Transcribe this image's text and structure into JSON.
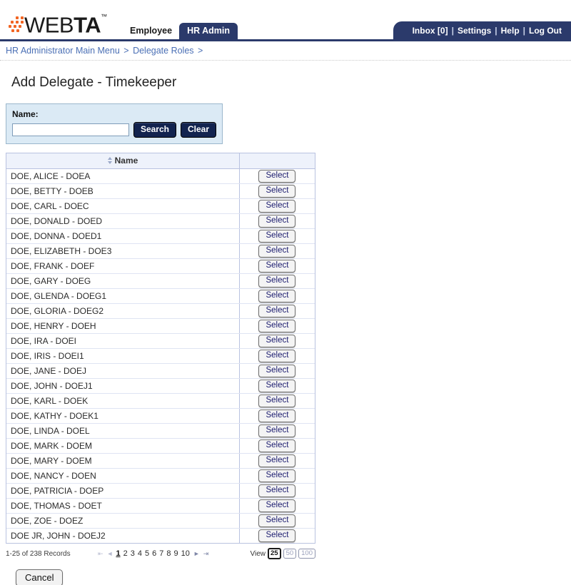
{
  "header": {
    "logo_light": "WEB",
    "logo_bold": "TA",
    "logo_tm": "™",
    "tabs": [
      {
        "label": "Employee",
        "active": false
      },
      {
        "label": "HR Admin",
        "active": true
      }
    ],
    "topnav": [
      {
        "label": "Inbox [0]"
      },
      {
        "label": "Settings"
      },
      {
        "label": "Help"
      },
      {
        "label": "Log Out"
      }
    ],
    "topnav_separator": "|",
    "brand_color": "#2b3a6b",
    "accent_color": "#f26522"
  },
  "breadcrumb": {
    "items": [
      {
        "label": "HR Administrator Main Menu"
      },
      {
        "label": "Delegate Roles"
      }
    ],
    "separator": ">",
    "trailing_separator": ">"
  },
  "page": {
    "title": "Add Delegate - Timekeeper"
  },
  "search": {
    "name_label": "Name:",
    "name_value": "",
    "name_placeholder": "",
    "search_button": "Search",
    "clear_button": "Clear"
  },
  "table": {
    "columns": [
      {
        "key": "name",
        "label": "Name",
        "sortable": true
      },
      {
        "key": "action",
        "label": "",
        "sortable": false
      }
    ],
    "action_label": "Select",
    "rows": [
      {
        "name": "DOE, ALICE - DOEA"
      },
      {
        "name": "DOE, BETTY - DOEB"
      },
      {
        "name": "DOE, CARL - DOEC"
      },
      {
        "name": "DOE, DONALD - DOED"
      },
      {
        "name": "DOE, DONNA - DOED1"
      },
      {
        "name": "DOE, ELIZABETH - DOE3"
      },
      {
        "name": "DOE, FRANK - DOEF"
      },
      {
        "name": "DOE, GARY - DOEG"
      },
      {
        "name": "DOE, GLENDA - DOEG1"
      },
      {
        "name": "DOE, GLORIA - DOEG2"
      },
      {
        "name": "DOE, HENRY - DOEH"
      },
      {
        "name": "DOE, IRA - DOEI"
      },
      {
        "name": "DOE, IRIS - DOEI1"
      },
      {
        "name": "DOE, JANE - DOEJ"
      },
      {
        "name": "DOE, JOHN - DOEJ1"
      },
      {
        "name": "DOE, KARL - DOEK"
      },
      {
        "name": "DOE, KATHY - DOEK1"
      },
      {
        "name": "DOE, LINDA - DOEL"
      },
      {
        "name": "DOE, MARK - DOEM"
      },
      {
        "name": "DOE, MARY - DOEM"
      },
      {
        "name": "DOE, NANCY - DOEN"
      },
      {
        "name": "DOE, PATRICIA - DOEP"
      },
      {
        "name": "DOE, THOMAS - DOET"
      },
      {
        "name": "DOE, ZOE - DOEZ"
      },
      {
        "name": "DOE JR, JOHN - DOEJ2"
      }
    ]
  },
  "pager": {
    "records_text": "1-25 of 238 Records",
    "first_arrow": "⇤",
    "prev_arrow": "◄",
    "next_arrow": "►",
    "last_arrow": "⇥",
    "pages": [
      "1",
      "2",
      "3",
      "4",
      "5",
      "6",
      "7",
      "8",
      "9",
      "10"
    ],
    "current_page": "1",
    "view_label": "View",
    "view_options": [
      {
        "label": "25",
        "selected": true
      },
      {
        "label": "50",
        "selected": false
      },
      {
        "label": "100",
        "selected": false
      }
    ]
  },
  "footer": {
    "cancel_button": "Cancel"
  }
}
